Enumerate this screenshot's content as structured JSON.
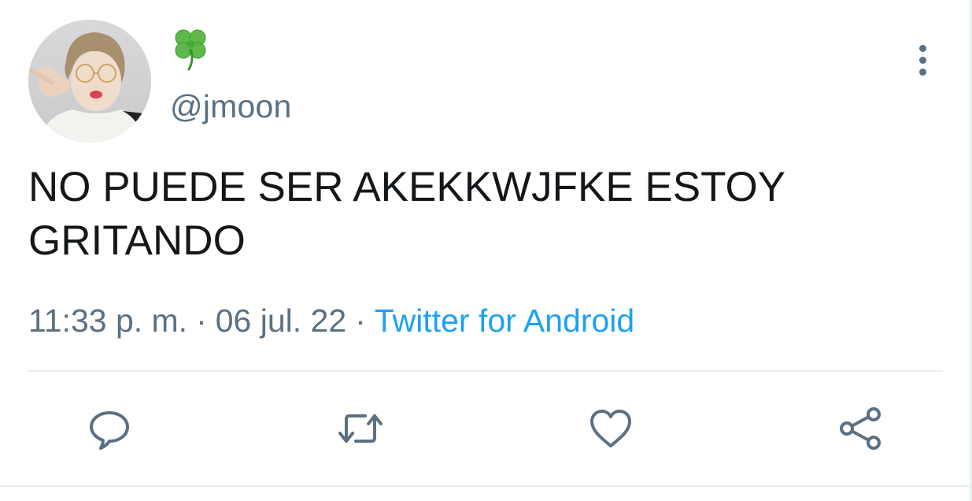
{
  "user": {
    "display_name_icon": "four-leaf-clover-icon",
    "handle": "@jmoon"
  },
  "tweet": {
    "text": "NO PUEDE SER AKEKKWJFKE ESTOY GRITANDO",
    "time": "11:33 p. m.",
    "separator": "·",
    "date": "06 jul. 22",
    "source": "Twitter for Android"
  },
  "actions": {
    "reply_icon": "reply-icon",
    "retweet_icon": "retweet-icon",
    "like_icon": "heart-icon",
    "share_icon": "share-icon"
  },
  "colors": {
    "text": "#14171a",
    "secondary": "#5b7083",
    "link": "#1da1f2",
    "divider": "#e6ecf0"
  }
}
